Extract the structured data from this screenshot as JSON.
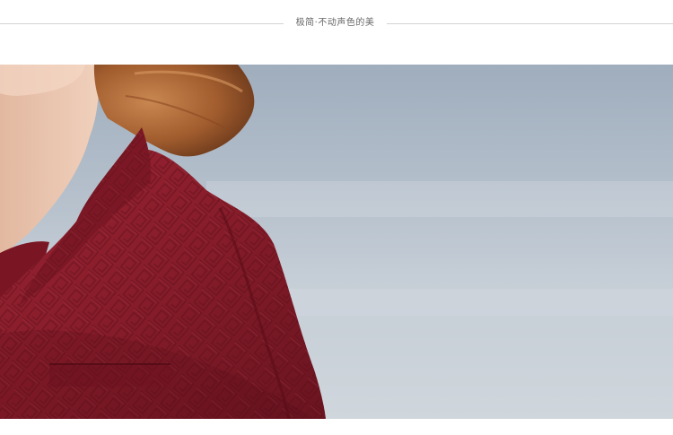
{
  "header": {
    "tagline": "极简·不动声色的美"
  },
  "photo": {
    "subject": "woman-in-red-textured-coat",
    "colors": {
      "coat": "#8e1f2c",
      "coat_shadow": "#5e0f19",
      "hair": "#b06a3a",
      "skin": "#e9c4ad",
      "background": "#b8c2cd"
    }
  }
}
